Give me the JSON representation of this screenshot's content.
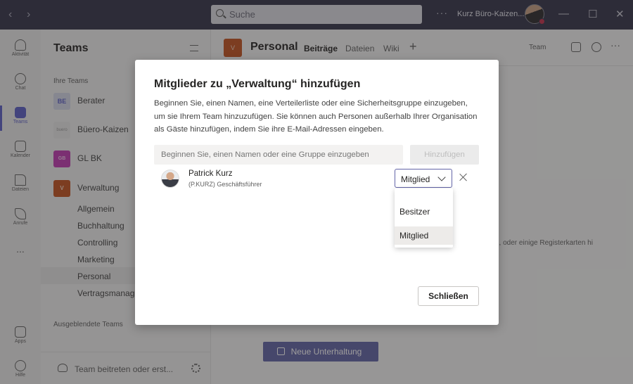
{
  "titlebar": {
    "search_placeholder": "Suche",
    "user_name": "Kurz Büro-Kaizen...",
    "back": "‹",
    "forward": "›",
    "more": "···",
    "minimize": "—",
    "maximize": "☐",
    "close": "✕"
  },
  "rail": {
    "items": [
      {
        "label": "Aktivität"
      },
      {
        "label": "Chat"
      },
      {
        "label": "Teams"
      },
      {
        "label": "Kalender"
      },
      {
        "label": "Dateien"
      },
      {
        "label": "Anrufe"
      },
      {
        "label": "..."
      },
      {
        "label": "Apps"
      },
      {
        "label": "Hilfe"
      }
    ]
  },
  "sidebar": {
    "title": "Teams",
    "section_your_teams": "Ihre Teams",
    "teams": [
      {
        "initials": "BE",
        "name": "Berater",
        "color": "#d5d9e9",
        "text_color": "#5b5fc7"
      },
      {
        "initials": "buero",
        "name": "Büero-Kaizen",
        "color": "#eaeaea",
        "text_color": "#999999"
      },
      {
        "initials": "GB",
        "name": "GL BK",
        "color": "#c239b3",
        "text_color": "#f2c6ec"
      },
      {
        "initials": "V",
        "name": "Verwaltung",
        "color": "#c4531f",
        "text_color": "#f5d4c2"
      }
    ],
    "channels": [
      "Allgemein",
      "Buchhaltung",
      "Controlling",
      "Marketing",
      "Personal",
      "Vertragsmanag..."
    ],
    "section_hidden": "Ausgeblendete Teams",
    "join_label": "Team beitreten oder erst..."
  },
  "main": {
    "channel_initial": "V",
    "channel_title": "Personal",
    "tabs": [
      "Beiträge",
      "Dateien",
      "Wiki"
    ],
    "add_tab": "+",
    "team_button": "Team",
    "hint_text": "n, oder einige Registerkarten hi",
    "new_conversation": "Neue Unterhaltung",
    "more": "···"
  },
  "dialog": {
    "title": "Mitglieder zu „Verwaltung“ hinzufügen",
    "description": "Beginnen Sie, einen Namen, eine Verteilerliste oder eine Sicherheitsgruppe einzugeben, um sie Ihrem Team hinzuzufügen. Sie können auch Personen außerhalb Ihrer Organisation als Gäste hinzufügen, indem Sie ihre E-Mail-Adressen eingeben.",
    "input_placeholder": "Beginnen Sie, einen Namen oder eine Gruppe einzugeben",
    "add_button": "Hinzufügen",
    "person": {
      "name": "Patrick Kurz",
      "subtitle": "(P.KURZ) Geschäftsführer"
    },
    "role_selected": "Mitglied",
    "role_options": [
      "Besitzer",
      "Mitglied"
    ],
    "close_button": "Schließen"
  },
  "colors": {
    "accent": "#6264a7",
    "titlebar": "#33344a"
  }
}
